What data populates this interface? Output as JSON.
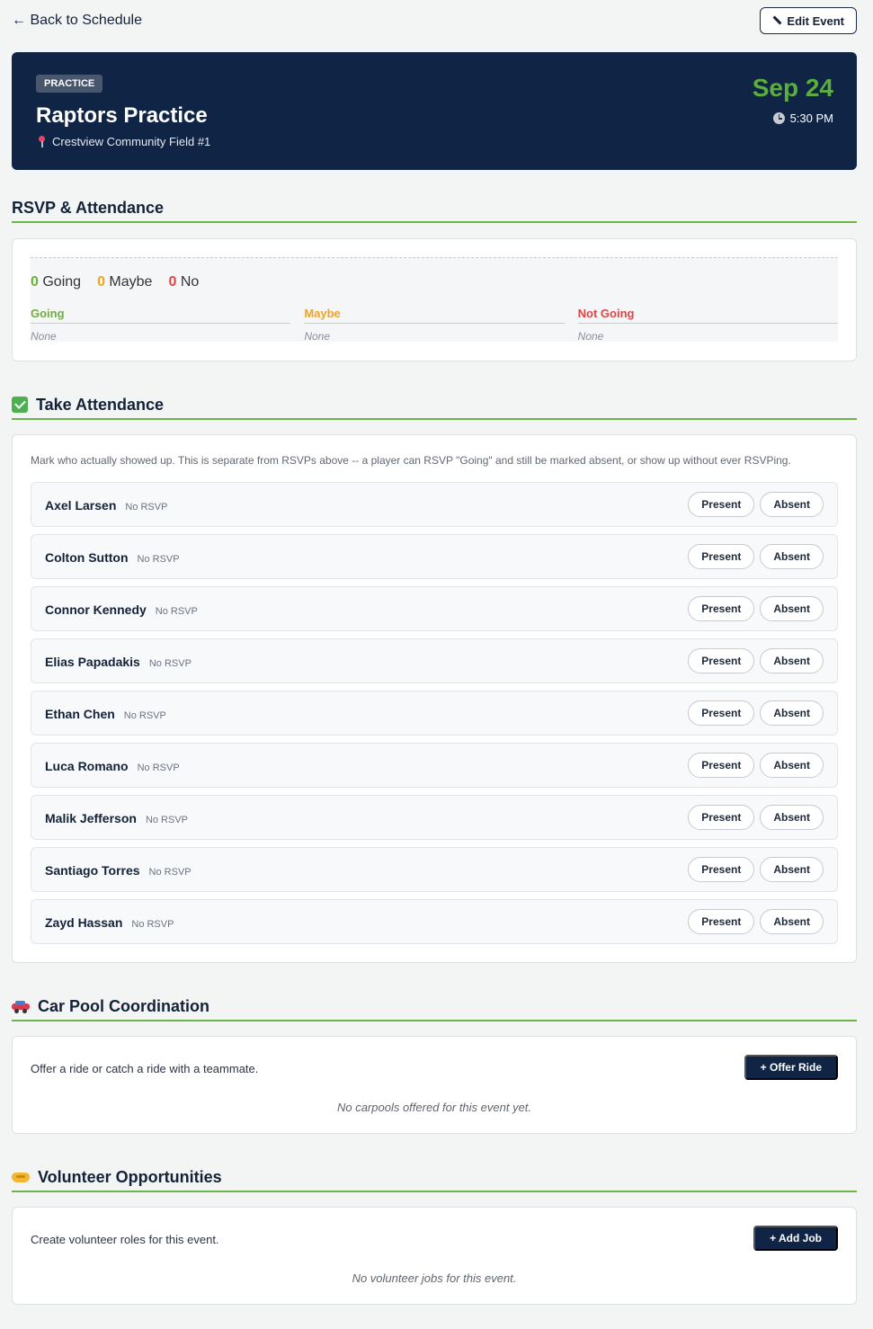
{
  "nav": {
    "back_label": "← Back to Schedule",
    "edit_label": "Edit Event"
  },
  "event": {
    "badge": "PRACTICE",
    "title": "Raptors Practice",
    "location": "Crestview Community Field #1",
    "date": "Sep 24",
    "time": "5:30 PM"
  },
  "rsvp": {
    "heading": "RSVP & Attendance",
    "going_count": "0",
    "going_word": "Going",
    "maybe_count": "0",
    "maybe_word": "Maybe",
    "no_count": "0",
    "no_word": "No",
    "columns": [
      {
        "label": "Going",
        "value": "None"
      },
      {
        "label": "Maybe",
        "value": "None"
      },
      {
        "label": "Not Going",
        "value": "None"
      }
    ]
  },
  "attendance": {
    "heading": "Take Attendance",
    "description": "Mark who actually showed up. This is separate from RSVPs above -- a player can RSVP \"Going\" and still be marked absent, or show up without ever RSVPing.",
    "present_label": "Present",
    "absent_label": "Absent",
    "players": [
      {
        "name": "Axel Larsen",
        "rsvp": "No RSVP"
      },
      {
        "name": "Colton Sutton",
        "rsvp": "No RSVP"
      },
      {
        "name": "Connor Kennedy",
        "rsvp": "No RSVP"
      },
      {
        "name": "Elias Papadakis",
        "rsvp": "No RSVP"
      },
      {
        "name": "Ethan Chen",
        "rsvp": "No RSVP"
      },
      {
        "name": "Luca Romano",
        "rsvp": "No RSVP"
      },
      {
        "name": "Malik Jefferson",
        "rsvp": "No RSVP"
      },
      {
        "name": "Santiago Torres",
        "rsvp": "No RSVP"
      },
      {
        "name": "Zayd Hassan",
        "rsvp": "No RSVP"
      }
    ]
  },
  "carpool": {
    "heading": "Car Pool Coordination",
    "text": "Offer a ride or catch a ride with a teammate.",
    "button": "+ Offer Ride",
    "empty": "No carpools offered for this event yet."
  },
  "volunteer": {
    "heading": "Volunteer Opportunities",
    "text": "Create volunteer roles for this event.",
    "button": "+ Add Job",
    "empty": "No volunteer jobs for this event."
  },
  "colors": {
    "navy": "#102445",
    "accent_green": "#5aad3e",
    "maybe_orange": "#f0a326",
    "no_red": "#e24444"
  },
  "icons": [
    "pencil-icon",
    "pin-icon",
    "clock-icon",
    "check-icon",
    "car-icon",
    "handshake-icon"
  ]
}
